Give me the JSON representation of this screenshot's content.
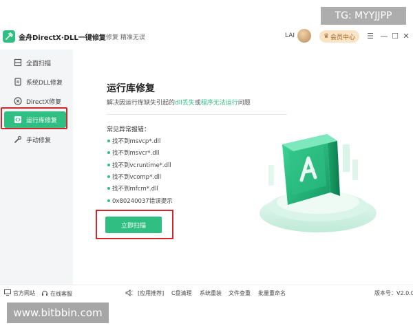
{
  "titlebar": {
    "app_name": "金舟DirectX·DLL一键修复",
    "slogan": "金舟修复 精准无误",
    "user_name": "LAI",
    "vip_label": "会员中心",
    "menu_symbol": "☰",
    "minimize_symbol": "—",
    "maximize_symbol": "☐",
    "close_symbol": "✕"
  },
  "sidebar": {
    "items": [
      {
        "label": "全面扫描",
        "icon": "scan-icon"
      },
      {
        "label": "系统DLL修复",
        "icon": "dll-icon"
      },
      {
        "label": "DirectX修复",
        "icon": "directx-icon"
      },
      {
        "label": "运行库修复",
        "icon": "runtime-icon",
        "active": true
      },
      {
        "label": "手动修复",
        "icon": "wrench-icon"
      }
    ]
  },
  "main": {
    "title": "运行库修复",
    "desc_prefix": "解决因运行库缺失引起的",
    "desc_hl1": "dll丢失",
    "desc_mid": "或",
    "desc_hl2": "程序无法运行",
    "desc_suffix": "问题",
    "common_label": "常见异常报错：",
    "errors": [
      "找不到msvcp*.dll",
      "找不到msvcr*.dll",
      "找不到vcruntime*.dll",
      "找不到vcomp*.dll",
      "找不到mfcm*.dll",
      "0x80240037错误提示"
    ],
    "scan_button": "立即扫描"
  },
  "footer": {
    "website": "官方网站",
    "service": "在线客服",
    "recommend": "[应用推荐]",
    "links": [
      "C盘清理",
      "系统重装",
      "文件查重",
      "批量重命名"
    ],
    "version": "版本号：V2.0.0"
  },
  "watermarks": {
    "top": "TG: MYYJJPP",
    "bottom": "www.bitbbin.com"
  },
  "colors": {
    "accent": "#2fbf83",
    "highlight_border": "#d2262a"
  }
}
